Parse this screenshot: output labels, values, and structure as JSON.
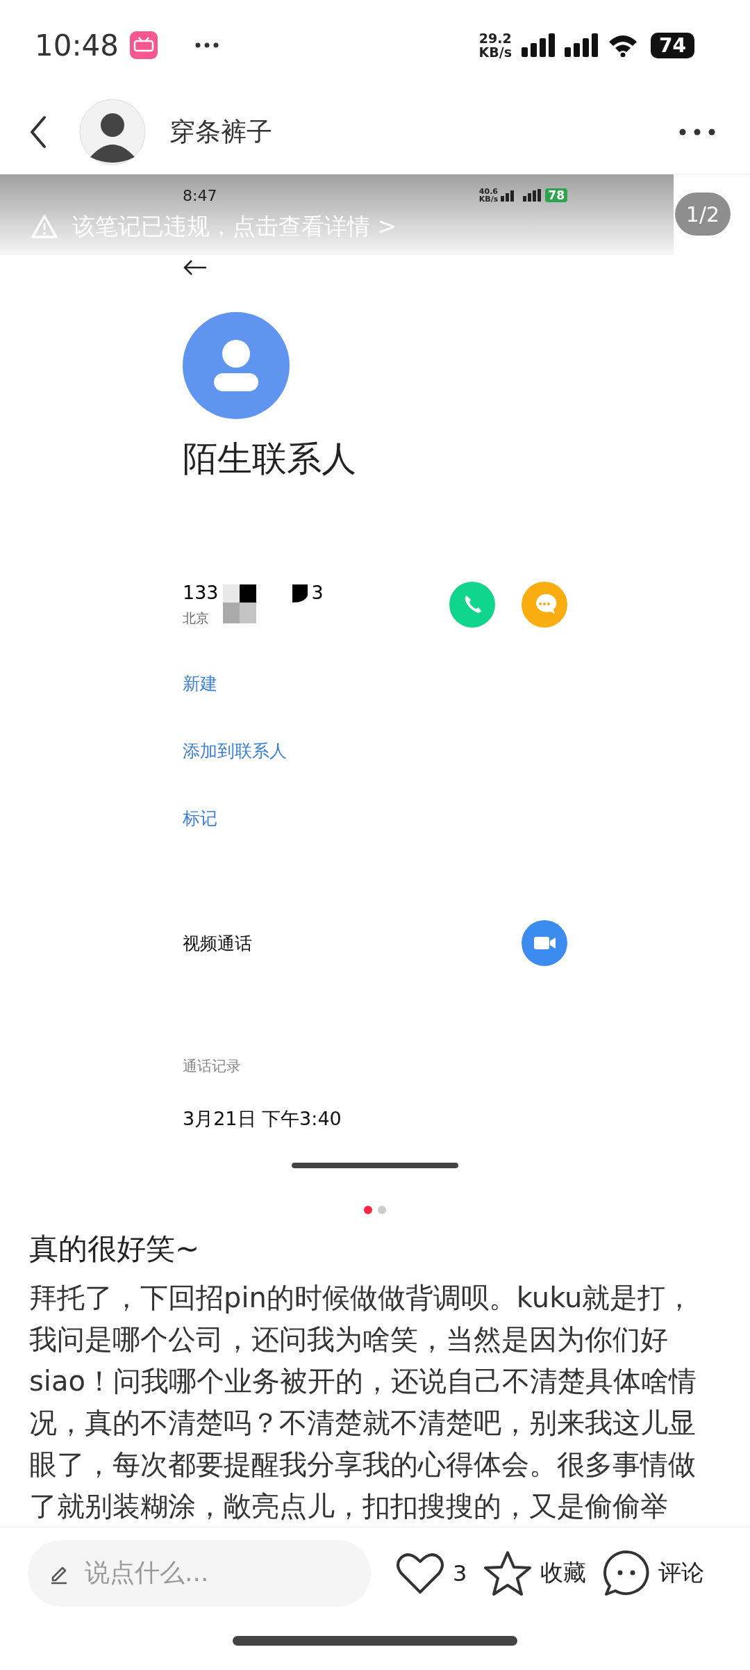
{
  "status_bar": {
    "time": "10:48",
    "net_speed": "29.2",
    "net_unit": "KB/s",
    "battery": "74"
  },
  "header": {
    "author": "穿条裤子"
  },
  "gallery": {
    "violation_notice": "该笔记已违规，点击查看详情 >",
    "page_counter": "1/2",
    "dots": [
      {
        "selected": true
      },
      {
        "selected": false
      }
    ],
    "screenshot": {
      "time": "8:47",
      "net_speed": "40.6",
      "net_unit": "KB/s",
      "battery": "78",
      "contact_name": "陌生联系人",
      "number_start": "133",
      "number_end": "3",
      "location": "北京",
      "actions": [
        {
          "kind": "link",
          "label": "新建"
        },
        {
          "kind": "link",
          "label": "添加到联系人"
        },
        {
          "kind": "link",
          "label": "标记"
        },
        {
          "kind": "video",
          "label": "视频通话"
        }
      ],
      "call_log_heading": "通话记录",
      "call_time": "3月21日 下午3:40"
    }
  },
  "post": {
    "title": "真的很好笑~",
    "body_lines": [
      "拜托了，下回招pin的时候做做背调呗。kuku就是打，",
      "我问是哪个公司，还问我为啥笑，当然是因为你们好",
      "siao！问我哪个业务被开的，还说自己不清楚具体啥情",
      "况，真的不清楚吗？不清楚就不清楚吧，别来我这儿显",
      "眼了，每次都要提醒我分享我的心得体会。很多事情做",
      "了就别装糊涂，敞亮点儿，扣扣搜搜的，又是偷偷举"
    ]
  },
  "bottom_bar": {
    "comment_placeholder": "说点什么...",
    "likes": "3",
    "liked": false,
    "collect_label": "收藏",
    "comment_label": "评论"
  }
}
